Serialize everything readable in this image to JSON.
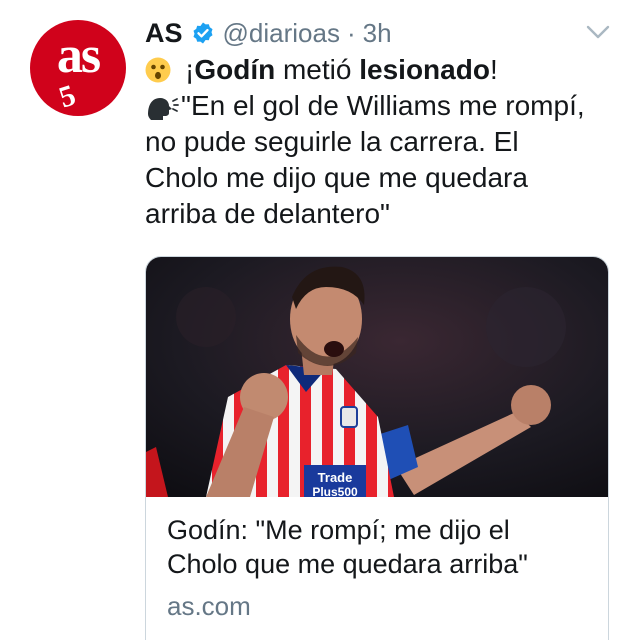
{
  "avatar": {
    "brand_text": "as",
    "anniversary_text": "5",
    "icon": "as-logo-avatar"
  },
  "header": {
    "name": "AS",
    "handle": "@diarioas",
    "separator": "·",
    "time": "3h",
    "verified_icon": "verified-badge-icon",
    "menu_icon": "chevron-down-icon"
  },
  "tweet": {
    "line1_prefix": "¡",
    "line1_bold1": "Godín",
    "line1_mid": " metió ",
    "line1_bold2": "lesionado",
    "line1_suffix": "!",
    "line2": "\"En el gol de Williams me rompí,",
    "line3": "no pude seguirle la carrera. El",
    "line4": "Cholo me dijo que me quedara",
    "line5": "arriba de delantero\"",
    "emoji1": "astonished-face-emoji",
    "emoji2": "speaking-head-emoji"
  },
  "card": {
    "title_line1": "Godín: \"Me rompí; me dijo el",
    "title_line2": "Cholo que me quedara arriba\"",
    "domain": "as.com",
    "image_shirt_text": "Trade",
    "image_shirt_text2": "Plus500"
  },
  "colors": {
    "brand_red": "#d0021b",
    "verified_blue": "#1da1f2",
    "secondary_text": "#657786",
    "border": "#ccd6dd"
  }
}
